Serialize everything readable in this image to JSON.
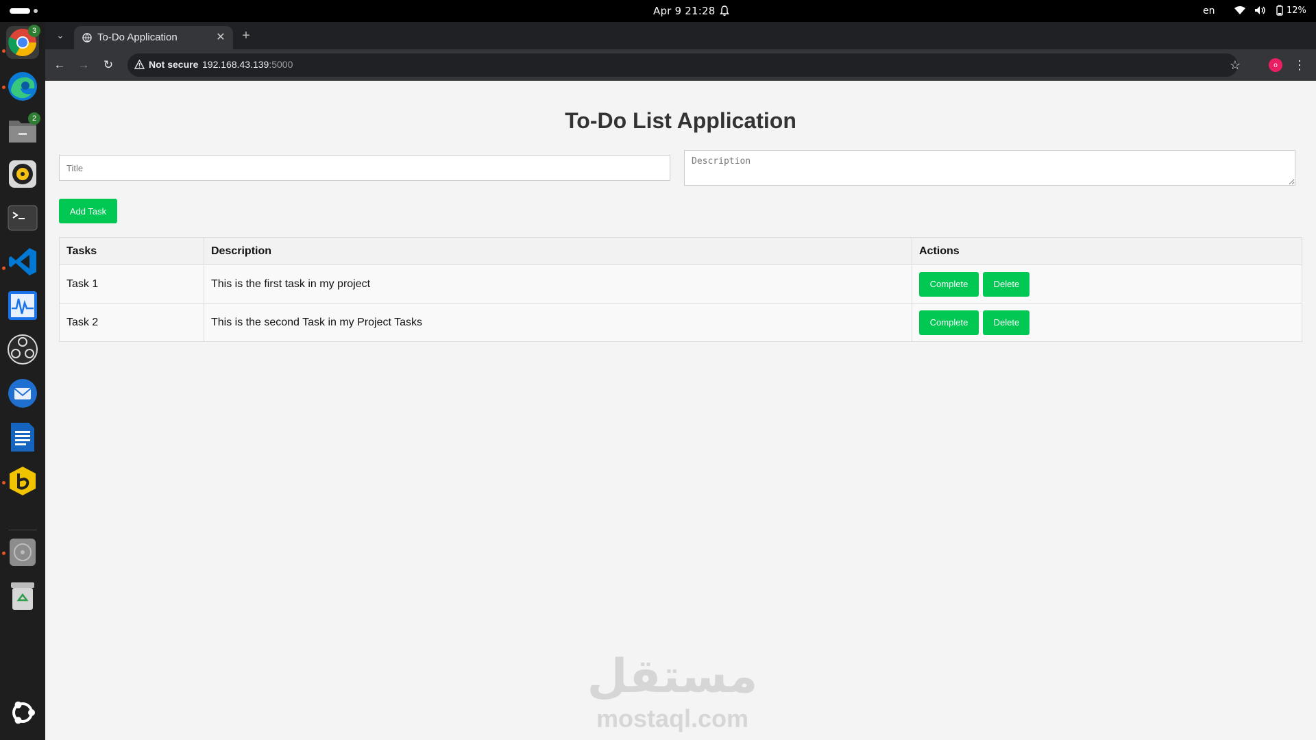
{
  "system": {
    "clock": "Apr 9  21:28",
    "language": "en",
    "battery": "12%"
  },
  "dock": {
    "items": [
      {
        "name": "chrome",
        "badge": "3"
      },
      {
        "name": "edge"
      },
      {
        "name": "files",
        "badge": "2"
      },
      {
        "name": "rhythmbox"
      },
      {
        "name": "terminal"
      },
      {
        "name": "vscode"
      },
      {
        "name": "system-monitor"
      },
      {
        "name": "obs"
      },
      {
        "name": "thunderbird"
      },
      {
        "name": "writer"
      },
      {
        "name": "bitwarden"
      },
      {
        "name": "disks"
      },
      {
        "name": "trash"
      },
      {
        "name": "ubuntu"
      }
    ]
  },
  "browser": {
    "tab_title": "To-Do Application",
    "security_label": "Not secure",
    "url_host": "192.168.43.139",
    "url_port": ":5000",
    "profile_initial": "o"
  },
  "page": {
    "title": "To-Do List Application",
    "title_placeholder": "Title",
    "description_placeholder": "Description",
    "add_task_label": "Add Task",
    "table": {
      "headers": [
        "Tasks",
        "Description",
        "Actions"
      ],
      "rows": [
        {
          "task": "Task 1",
          "description": "This is the first task in my project",
          "complete_label": "Complete",
          "delete_label": "Delete"
        },
        {
          "task": "Task 2",
          "description": "This is the second Task in my Project Tasks",
          "complete_label": "Complete",
          "delete_label": "Delete"
        }
      ]
    }
  },
  "watermark": {
    "logo": "مستقل",
    "text": "mostaql.com"
  },
  "colors": {
    "accent_green": "#00c853",
    "browser_dark": "#202124",
    "browser_toolbar": "#35363a"
  }
}
